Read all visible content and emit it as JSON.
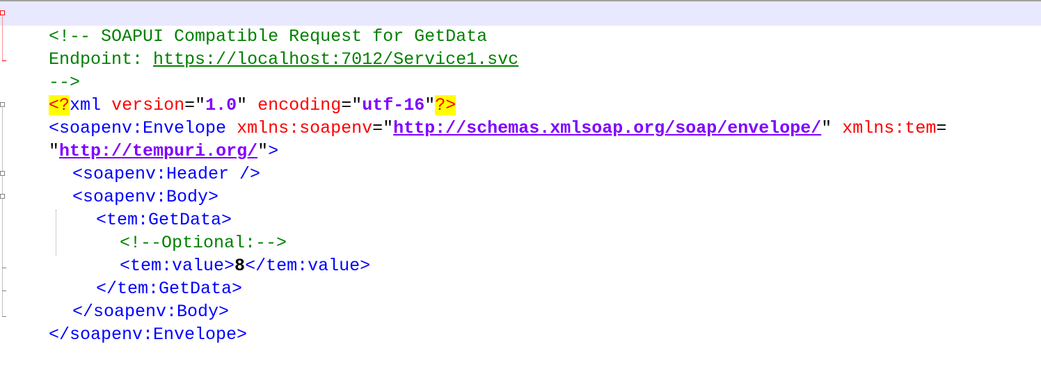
{
  "editor": {
    "lines": [
      {
        "kind": "comment",
        "text": "<!-- SOAPUI Compatible Request for GetData"
      },
      {
        "kind": "comment-link",
        "prefix": "Endpoint: ",
        "link": "https://localhost:7012/Service1.svc"
      },
      {
        "kind": "comment",
        "text": "-->"
      },
      {
        "kind": "decl",
        "open": "<?",
        "name": "xml",
        "attr1": "version",
        "eq": "=",
        "q": "\"",
        "val1": "1.0",
        "attr2": "encoding",
        "val2": "utf-16",
        "close": "?>"
      },
      {
        "kind": "envelope-open",
        "tag": "<soapenv:Envelope",
        "attr1": "xmlns:soapenv",
        "val1": "http://schemas.xmlsoap.org/soap/envelope/",
        "attr2": "xmlns:tem"
      },
      {
        "kind": "envelope-cont",
        "val": "http://tempuri.org/",
        "end": ">"
      },
      {
        "kind": "tag",
        "text": "<soapenv:Header />"
      },
      {
        "kind": "tag",
        "text": "<soapenv:Body>"
      },
      {
        "kind": "tag",
        "text": "<tem:GetData>"
      },
      {
        "kind": "comment",
        "text": "<!--Optional:-->"
      },
      {
        "kind": "value",
        "open": "<tem:value>",
        "value": "8",
        "close": "</tem:value>"
      },
      {
        "kind": "tag",
        "text": "</tem:GetData>"
      },
      {
        "kind": "tag",
        "text": "</soapenv:Body>"
      },
      {
        "kind": "tag",
        "text": "</soapenv:Envelope>"
      }
    ]
  },
  "colors": {
    "comment": "#008000",
    "tag": "#0000ff",
    "attribute": "#ff0000",
    "value": "#8000ff",
    "highlight": "#ffff00"
  }
}
